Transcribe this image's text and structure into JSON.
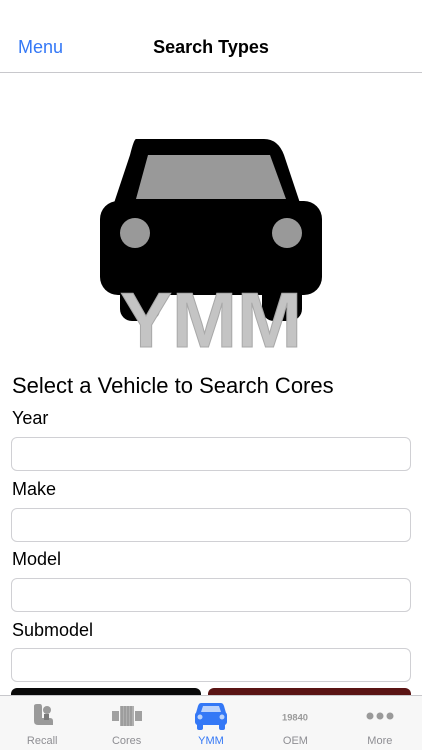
{
  "nav": {
    "back_label": "Menu",
    "title": "Search Types"
  },
  "hero": {
    "logo_text": "YMM"
  },
  "form": {
    "heading": "Select a Vehicle to Search Cores",
    "fields": [
      {
        "label": "Year",
        "value": ""
      },
      {
        "label": "Make",
        "value": ""
      },
      {
        "label": "Model",
        "value": ""
      },
      {
        "label": "Submodel",
        "value": ""
      }
    ]
  },
  "tabs": [
    {
      "label": "Recall",
      "icon": "seat-icon",
      "active": false
    },
    {
      "label": "Cores",
      "icon": "core-icon",
      "active": false
    },
    {
      "label": "YMM",
      "icon": "car-icon",
      "active": true
    },
    {
      "label": "OEM",
      "icon": "oem-number-icon",
      "icon_text": "19840",
      "active": false
    },
    {
      "label": "More",
      "icon": "more-icon",
      "active": false
    }
  ],
  "colors": {
    "accent": "#3478f6",
    "inactive": "#8e8e93",
    "button_dark": "#0a0a0a",
    "button_red": "#5a1414"
  }
}
